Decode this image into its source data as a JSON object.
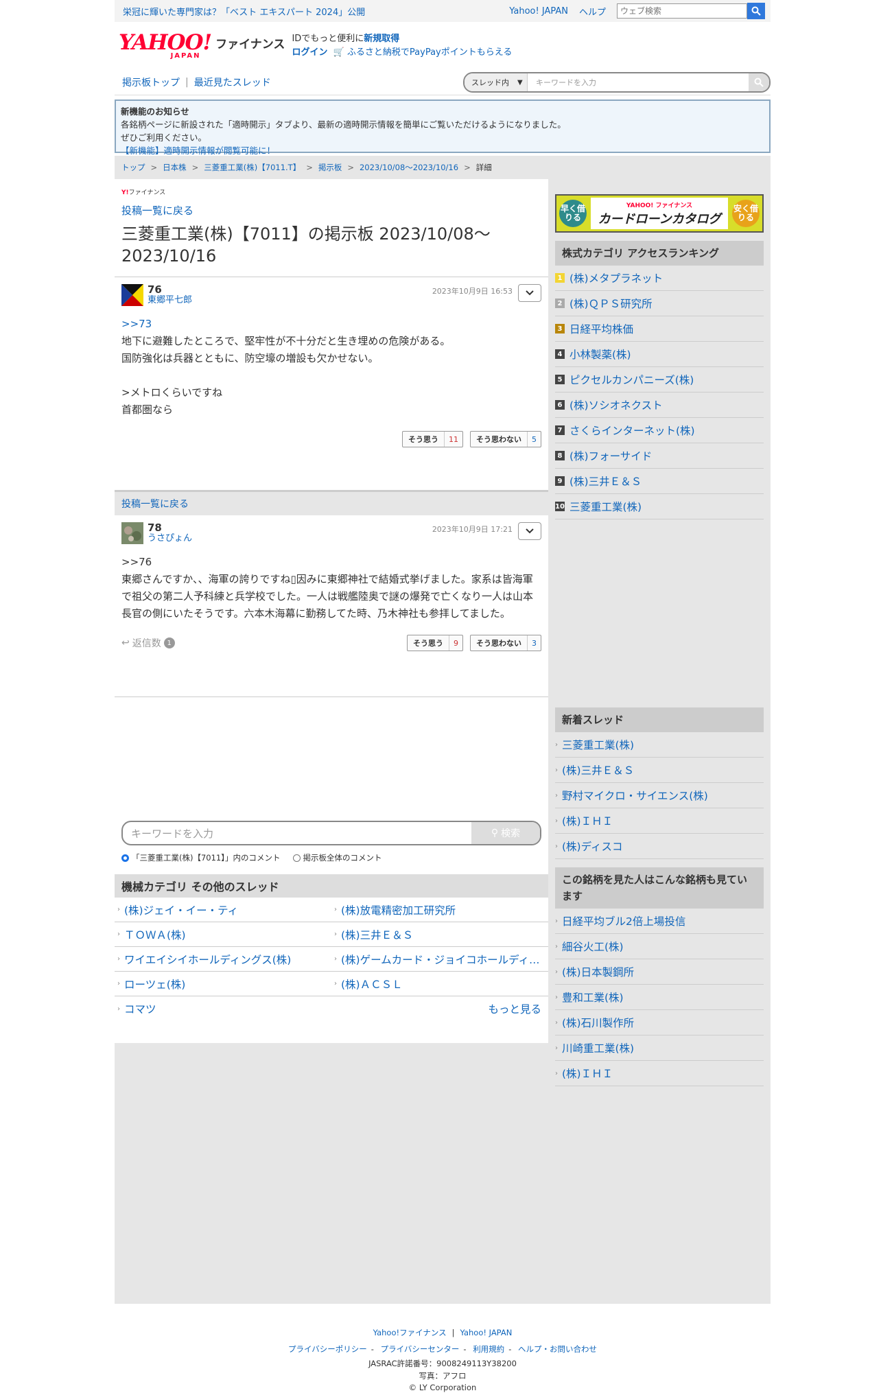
{
  "topbar": {
    "promo": "栄冠に輝いた専門家は？「ベスト エキスパート 2024」公開",
    "link1": "Yahoo! JAPAN",
    "link2": "ヘルプ",
    "search_placeholder": "ウェブ検索"
  },
  "header": {
    "logo_text": "YAHOO!",
    "logo_sub": "JAPAN",
    "brand": "ファイナンス",
    "line1_text": "IDでもっと便利に",
    "line1_link": "新規取得",
    "login": "ログイン",
    "furusato": "ふるさと納税でPayPayポイントもらえる"
  },
  "nav": {
    "board_top": "掲示板トップ",
    "recent": "最近見たスレッド",
    "scope": "スレッド内",
    "search_placeholder": "キーワードを入力"
  },
  "notice": {
    "title": "新機能のお知らせ",
    "line1": "各銘柄ページに新設された「適時開示」タブより、最新の適時開示情報を簡単にご覧いただけるようになりました。",
    "line2": "ぜひご利用ください。",
    "link": "【新機能】適時開示情報が閲覧可能に！"
  },
  "breadcrumb": [
    "トップ",
    "日本株",
    "三菱重工業(株)【7011.T】",
    "掲示板",
    "2023/10/08〜2023/10/16",
    "詳細"
  ],
  "main": {
    "mini_brand": "ファイナンス",
    "back_label": "投稿一覧に戻る",
    "title": "三菱重工業(株)【7011】の掲示板 2023/10/08〜2023/10/16",
    "posts": [
      {
        "num": "76",
        "user": "東郷平七郎",
        "date": "2023年10月9日 16:53",
        "reply_to": ">>73",
        "body": "地下に避難したところで、堅牢性が不十分だと生き埋めの危険がある。\n国防強化は兵器とともに、防空壕の増設も欠かせない。\n\n>メトロくらいですね\n首都圏なら",
        "agree_label": "そう思う",
        "agree_count": "11",
        "disagree_label": "そう思わない",
        "disagree_count": "5"
      },
      {
        "num": "78",
        "user": "うさぴょん",
        "date": "2023年10月9日 17:21",
        "body": ">>76\n東郷さんですか、、海軍の誇りですね▯因みに東郷神社で結婚式挙げました。家系は皆海軍で祖父の第二人予科練と兵学校でした。一人は戦艦陸奥で謎の爆発で亡くなり一人は山本長官の側にいたそうです。六本木海幕に勤務してた時、乃木神社も参拝してました。",
        "reply_label": "返信数",
        "reply_count": "1",
        "agree_label": "そう思う",
        "agree_count": "9",
        "disagree_label": "そう思わない",
        "disagree_count": "3"
      }
    ],
    "backbar_label": "投稿一覧に戻る",
    "keyword_placeholder": "キーワードを入力",
    "search_button": "検索",
    "radio1": "「三菱重工業(株)【7011】」内のコメント",
    "radio2": "掲示板全体のコメント",
    "other_title": "機械カテゴリ その他のスレッド",
    "other_threads": [
      "(株)ジェイ・イー・ティ",
      "(株)放電精密加工研究所",
      "ＴＯＷＡ(株)",
      "(株)三井Ｅ＆Ｓ",
      "ワイエイシイホールディングス(株)",
      "(株)ゲームカード・ジョイコホールディングス",
      "ローツェ(株)",
      "(株)ＡＣＳＬ",
      "コマツ"
    ],
    "more": "もっと見る"
  },
  "side": {
    "ad_left": "早く借りる",
    "ad_brand": "YAHOO! ファイナンス",
    "ad_title": "カードローンカタログ",
    "ad_right": "安く借りる",
    "ranking_title": "株式カテゴリ アクセスランキング",
    "ranking": [
      {
        "rank": "1",
        "name": "(株)メタプラネット"
      },
      {
        "rank": "2",
        "name": "(株)ＱＰＳ研究所"
      },
      {
        "rank": "3",
        "name": "日経平均株価"
      },
      {
        "rank": "4",
        "name": "小林製薬(株)"
      },
      {
        "rank": "5",
        "name": "ピクセルカンパニーズ(株)"
      },
      {
        "rank": "6",
        "name": "(株)ソシオネクスト"
      },
      {
        "rank": "7",
        "name": "さくらインターネット(株)"
      },
      {
        "rank": "8",
        "name": "(株)フォーサイド"
      },
      {
        "rank": "9",
        "name": "(株)三井Ｅ＆Ｓ"
      },
      {
        "rank": "10",
        "name": "三菱重工業(株)"
      }
    ],
    "new_title": "新着スレッド",
    "new_threads": [
      "三菱重工業(株)",
      "(株)三井Ｅ＆Ｓ",
      "野村マイクロ・サイエンス(株)",
      "(株)ＩＨＩ",
      "(株)ディスコ"
    ],
    "also_title": "この銘柄を見た人はこんな銘柄も見ています",
    "also": [
      "日経平均ブル2倍上場投信",
      "細谷火工(株)",
      "(株)日本製鋼所",
      "豊和工業(株)",
      "(株)石川製作所",
      "川崎重工業(株)",
      "(株)ＩＨＩ"
    ]
  },
  "footer": {
    "l1a": "Yahoo!ファイナンス",
    "l1b": "Yahoo! JAPAN",
    "links": [
      "プライバシーポリシー",
      "プライバシーセンター",
      "利用規約",
      "ヘルプ・お問い合わせ"
    ],
    "jasrac": "JASRAC許諾番号：9008249113Y38200",
    "photo": "写真：アフロ",
    "copy": "© LY Corporation"
  }
}
